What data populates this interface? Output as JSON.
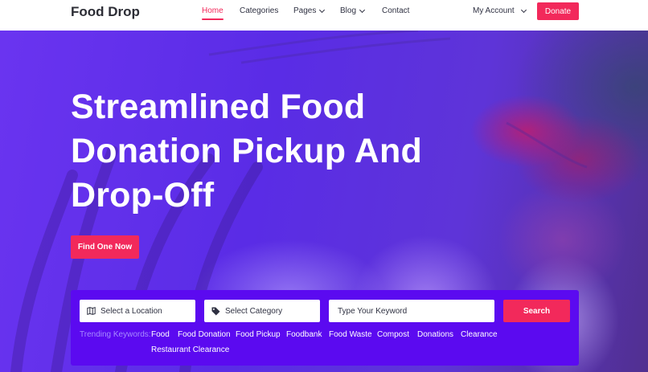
{
  "header": {
    "brand": "Food Drop",
    "nav": [
      {
        "label": "Home",
        "active": true,
        "has_dropdown": false
      },
      {
        "label": "Categories",
        "active": false,
        "has_dropdown": false
      },
      {
        "label": "Pages",
        "active": false,
        "has_dropdown": true
      },
      {
        "label": "Blog",
        "active": false,
        "has_dropdown": true
      },
      {
        "label": "Contact",
        "active": false,
        "has_dropdown": false
      }
    ],
    "account_label": "My Account",
    "donate_label": "Donate"
  },
  "hero": {
    "title_lines": [
      "Streamlined Food",
      "Donation Pickup And",
      "Drop-Off"
    ],
    "cta_label": "Find One Now"
  },
  "search": {
    "location_placeholder": "Select a Location",
    "category_placeholder": "Select Category",
    "keyword_placeholder": "Type Your Keyword",
    "button_label": "Search",
    "trending_label": "Trending Keywords:",
    "keywords": [
      "Food",
      "Food Donation",
      "Food Pickup",
      "Foodbank",
      "Food Waste",
      "Compost",
      "Donations",
      "Clearance",
      "Restaurant Clearance"
    ]
  },
  "colors": {
    "accent": "#f2295b",
    "panel": "#5b0af0",
    "hero_overlay": "#6a34f0",
    "text_dark": "#2c2d35"
  },
  "icons": {
    "location": "map-icon",
    "category": "tag-icon",
    "dropdown": "chevron-down-icon"
  }
}
